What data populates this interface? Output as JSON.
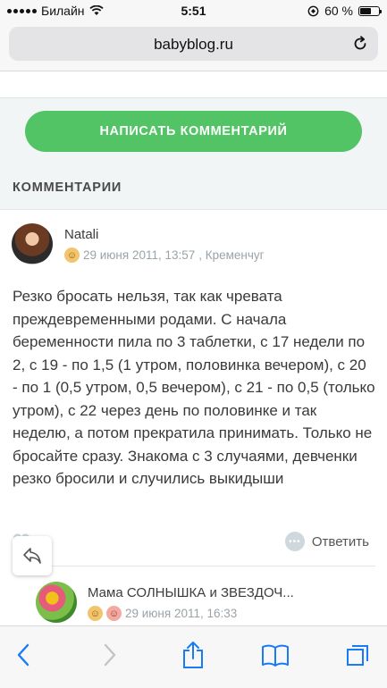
{
  "status_bar": {
    "carrier": "Билайн",
    "time": "5:51",
    "battery_percent": "60 %",
    "battery_level": 0.6
  },
  "browser": {
    "url": "babyblog.ru"
  },
  "page": {
    "write_comment_button": "НАПИСАТЬ КОММЕНТАРИЙ",
    "comments_heading": "КОММЕНТАРИИ"
  },
  "comments": [
    {
      "author": "Natali",
      "date": "29 июня 2011, 13:57",
      "location": ", Кременчуг",
      "text": "Резко бросать нельзя, так как чревата преждевременными родами. С начала беременности пила по 3 таблетки, с 17 недели по 2, с 19 - по 1,5 (1 утром, половинка вечером), с 20 - по 1 (0,5 утром, 0,5 вечером), с 21 - по 0,5 (только утром), с 22 через день по половинке и так неделю, а потом прекратила принимать. Только не бросайте сразу. Знакома с 3 случаями, девченки резко бросили и случились выкидыши",
      "reply_label": "Ответить"
    },
    {
      "author": "Мама СОЛНЫШКА и ЗВЕЗДОЧ...",
      "date": "29 июня 2011, 16:33"
    }
  ],
  "icons": {
    "wifi": "wifi-icon",
    "location": "location-lock-icon",
    "reload": "reload-icon",
    "back": "back-arrow-icon",
    "forward": "forward-arrow-icon",
    "share": "share-icon",
    "bookmarks": "bookmarks-icon",
    "tabs": "tabs-icon"
  },
  "colors": {
    "accent_green": "#53c465",
    "ios_blue": "#1a7cf5"
  }
}
